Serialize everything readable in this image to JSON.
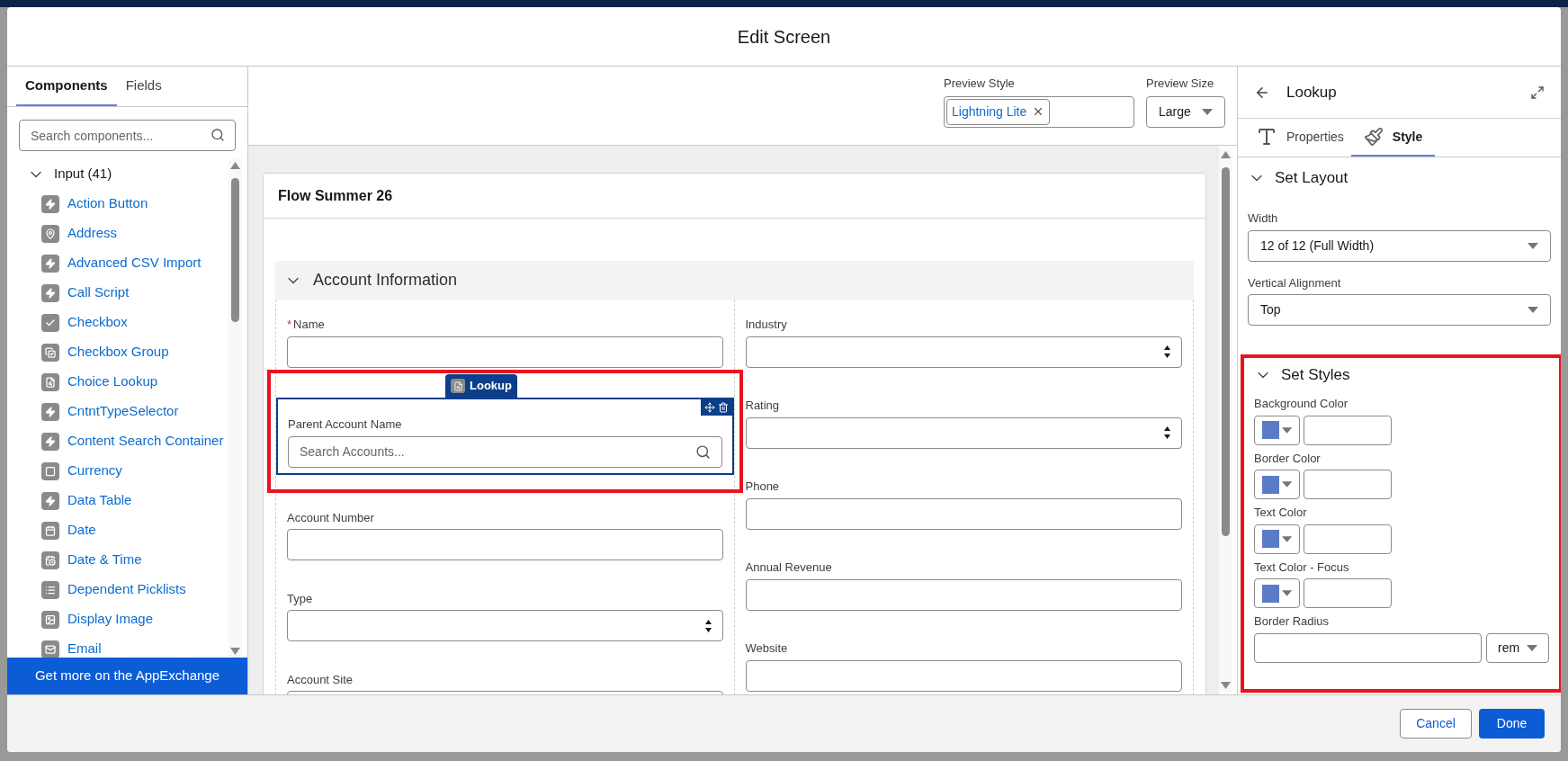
{
  "window": {
    "title": "Edit Screen"
  },
  "left_panel": {
    "tabs": [
      {
        "label": "Components",
        "selected": true
      },
      {
        "label": "Fields",
        "selected": false
      }
    ],
    "search": {
      "placeholder": "Search components..."
    },
    "tree": [
      {
        "label": "Input (41)",
        "expanded": true,
        "children": [
          {
            "label": "Action Button",
            "kind": "bolt"
          },
          {
            "label": "Address",
            "kind": "pin"
          },
          {
            "label": "Advanced CSV Import",
            "kind": "bolt"
          },
          {
            "label": "Call Script",
            "kind": "bolt"
          },
          {
            "label": "Checkbox",
            "kind": "check"
          },
          {
            "label": "Checkbox Group",
            "kind": "check-group"
          },
          {
            "label": "Choice Lookup",
            "kind": "lookup"
          },
          {
            "label": "CntntTypeSelector",
            "kind": "bolt"
          },
          {
            "label": "Content Search Container",
            "kind": "bolt"
          },
          {
            "label": "Currency",
            "kind": "currency"
          },
          {
            "label": "Data Table",
            "kind": "bolt"
          },
          {
            "label": "Date",
            "kind": "calendar"
          },
          {
            "label": "Date & Time",
            "kind": "calendar-clock"
          },
          {
            "label": "Dependent Picklists",
            "kind": "list"
          },
          {
            "label": "Display Image",
            "kind": "image"
          },
          {
            "label": "Email",
            "kind": "mail"
          }
        ]
      }
    ],
    "appexchange_button": "Get more on the AppExchange"
  },
  "preview": {
    "style_label": "Preview Style",
    "style_pill": "Lightning Lite",
    "size_label": "Preview Size",
    "size_value": "Large"
  },
  "canvas": {
    "screen_title": "Flow Summer 26",
    "section": {
      "title": "Account Information",
      "expanded": true
    },
    "columns": [
      [
        {
          "label": "Name",
          "kind": "text",
          "required_mark": "*",
          "selected": false
        },
        {
          "label": "Parent Account Name",
          "kind": "lookup",
          "selected": true,
          "highlighted": true,
          "badge": "Lookup",
          "placeholder": "Search Accounts..."
        },
        {
          "label": "Account Number",
          "kind": "text",
          "selected": false
        },
        {
          "label": "Type",
          "kind": "picklist",
          "selected": false
        },
        {
          "label": "Account Site",
          "kind": "text",
          "selected": false
        }
      ],
      [
        {
          "label": "Industry",
          "kind": "picklist",
          "selected": false
        },
        {
          "label": "Rating",
          "kind": "picklist",
          "selected": false
        },
        {
          "label": "Phone",
          "kind": "text",
          "selected": false
        },
        {
          "label": "Annual Revenue",
          "kind": "text",
          "selected": false
        },
        {
          "label": "Website",
          "kind": "text",
          "selected": false
        }
      ]
    ]
  },
  "properties_panel": {
    "title": "Lookup",
    "tabs": [
      {
        "label": "Properties",
        "kind": "properties",
        "selected": false
      },
      {
        "label": "Style",
        "kind": "style",
        "selected": true
      }
    ],
    "sections": [
      {
        "title": "Set Layout",
        "expanded": true,
        "highlighted": false,
        "fields": [
          {
            "kind": "select",
            "label": "Width",
            "value": "12 of 12 (Full Width)"
          },
          {
            "kind": "select",
            "label": "Vertical Alignment",
            "value": "Top"
          }
        ]
      },
      {
        "title": "Set Styles",
        "expanded": true,
        "highlighted": true,
        "fields": [
          {
            "kind": "color",
            "label": "Background Color",
            "color": "#5a7cc6"
          },
          {
            "kind": "color",
            "label": "Border Color",
            "color": "#5a7cc6"
          },
          {
            "kind": "color",
            "label": "Text Color",
            "color": "#5a7cc6"
          },
          {
            "kind": "color",
            "label": "Text Color - Focus",
            "color": "#5a7cc6"
          },
          {
            "kind": "radius",
            "label": "Border Radius",
            "unit": "rem"
          }
        ]
      }
    ]
  },
  "footer": {
    "buttons": [
      {
        "label": "Cancel",
        "kind": "neutral"
      },
      {
        "label": "Done",
        "kind": "brand"
      }
    ]
  }
}
